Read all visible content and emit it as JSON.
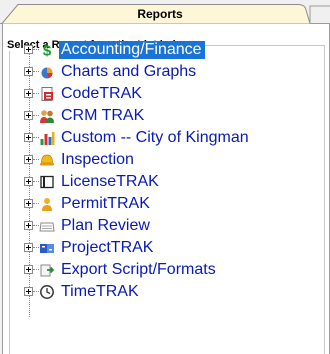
{
  "tabs": {
    "active": "Reports"
  },
  "group": {
    "title": "Select a Report from the List below"
  },
  "tree": {
    "items": [
      {
        "label": "Accounting/Finance",
        "icon": "dollar-icon",
        "selected": true
      },
      {
        "label": "Charts and Graphs",
        "icon": "pie-chart-icon"
      },
      {
        "label": "CodeTRAK",
        "icon": "code-document-icon"
      },
      {
        "label": "CRM TRAK",
        "icon": "people-icon"
      },
      {
        "label": "Custom -- City of Kingman",
        "icon": "bar-chart-icon"
      },
      {
        "label": "Inspection",
        "icon": "hard-hat-icon"
      },
      {
        "label": "LicenseTRAK",
        "icon": "license-icon"
      },
      {
        "label": "PermitTRAK",
        "icon": "permit-person-icon"
      },
      {
        "label": "Plan Review",
        "icon": "plan-review-icon"
      },
      {
        "label": "ProjectTRAK",
        "icon": "project-icon"
      },
      {
        "label": "Export Script/Formats",
        "icon": "export-icon"
      },
      {
        "label": "TimeTRAK",
        "icon": "clock-icon"
      }
    ]
  }
}
